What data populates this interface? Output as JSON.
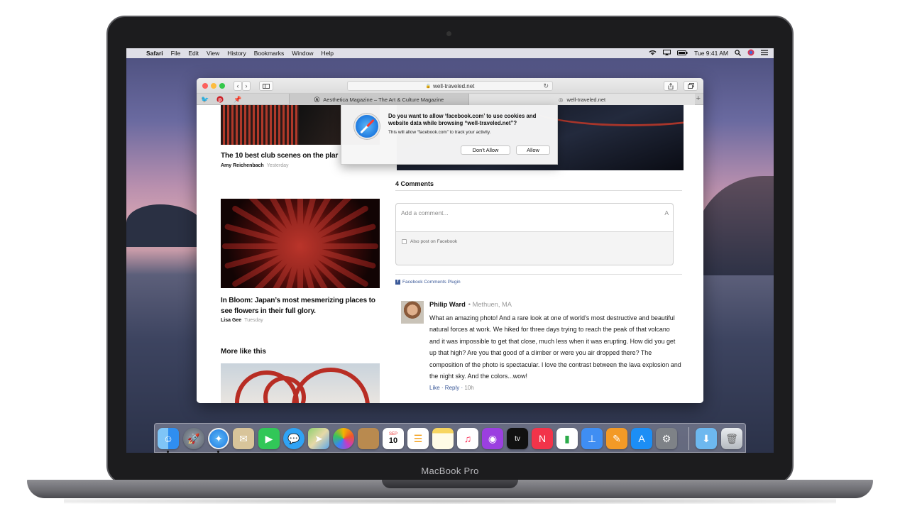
{
  "device": {
    "brand_label": "MacBook Pro"
  },
  "menubar": {
    "apple_glyph": "",
    "app_name": "Safari",
    "items": [
      "File",
      "Edit",
      "View",
      "History",
      "Bookmarks",
      "Window",
      "Help"
    ],
    "clock": "Tue 9:41 AM",
    "status_icons": [
      "wifi-icon",
      "airplay-icon",
      "battery-icon",
      "search-icon",
      "user-icon",
      "control-center-icon"
    ]
  },
  "safari": {
    "url": "well-traveled.net",
    "favorites": [
      "twitter-icon",
      "pinterest-icon",
      "pin-icon"
    ],
    "tabs": [
      {
        "icon": "aesthetica-icon",
        "title": "Aesthetica Magazine – The Art & Culture Magazine"
      },
      {
        "icon": "globe-icon",
        "title": "well-traveled.net"
      }
    ]
  },
  "dialog": {
    "title": "Do you want to allow ‘facebook.com’ to use cookies and website data while browsing “well-traveled.net”?",
    "subtitle": "This will allow “facebook.com” to track your activity.",
    "deny_label": "Don’t Allow",
    "allow_label": "Allow"
  },
  "articles": [
    {
      "title": "The 10 best club scenes on the plar",
      "author": "Amy Reichenbach",
      "when": "Yesterday"
    },
    {
      "title": "In Bloom: Japan’s most mesmerizing places to see flowers in their full glory.",
      "author": "Lisa Gee",
      "when": "Tuesday"
    }
  ],
  "more_heading": "More like this",
  "comments": {
    "heading": "4 Comments",
    "placeholder": "Add a comment...",
    "format_glyph": "A",
    "also_post": "Also post on Facebook",
    "plugin_label": "Facebook Comments Plugin",
    "items": [
      {
        "author": "Philip Ward",
        "location": "• Methuen, MA",
        "text": "What an amazing photo! And a rare look at one of world’s most destructive and beautiful natural forces at work. We hiked for three days trying to reach the peak of that volcano and it was impossible to get that close, much less when it was erupting. How did you get up that high? Are you that good of a climber or were you air dropped there? The composition of the photo is spectacular. I love the contrast between the lava explosion and the night sky. And the colors...wow!",
        "like": "Like",
        "reply": "Reply",
        "ago": "10h"
      }
    ]
  },
  "dock": {
    "apps": [
      "finder-icon",
      "launchpad-icon",
      "safari-icon",
      "mail-icon",
      "facetime-icon",
      "messages-icon",
      "maps-icon",
      "photos-icon",
      "notes-book-icon",
      "calendar-icon",
      "reminders-icon",
      "notes-icon",
      "music-icon",
      "podcasts-icon",
      "tv-icon",
      "news-icon",
      "numbers-icon",
      "keynote-icon",
      "pages-icon",
      "app-store-icon",
      "system-preferences-icon",
      "downloads-folder-icon",
      "trash-icon"
    ],
    "calendar_month": "SEP",
    "calendar_day": "10",
    "tv_label": "tv"
  }
}
